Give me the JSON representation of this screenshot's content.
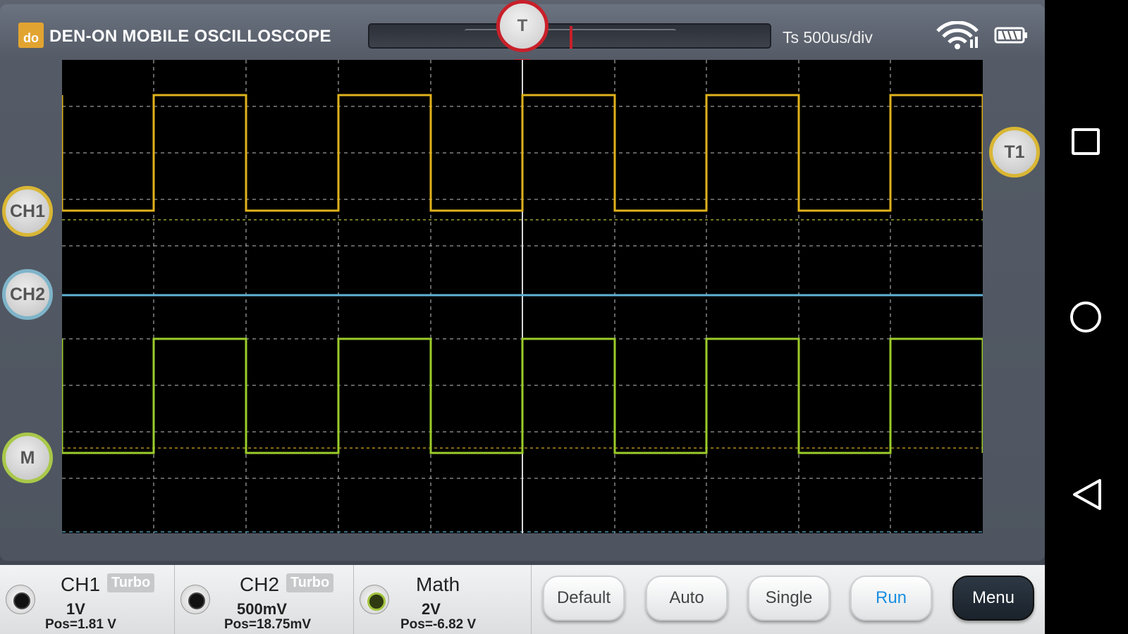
{
  "app": {
    "logo_text": "do",
    "title": "DEN-ON MOBILE OSCILLOSCOPE",
    "timebase": "Ts 500us/div",
    "trigger_label": "T"
  },
  "knobs": {
    "ch1": "CH1",
    "ch2": "CH2",
    "math": "M",
    "t1": "T1"
  },
  "channels": [
    {
      "name": "CH1",
      "badge": "Turbo",
      "scale": "1V",
      "pos": "Pos=1.81 V"
    },
    {
      "name": "CH2",
      "badge": "Turbo",
      "scale": "500mV",
      "pos": "Pos=18.75mV"
    },
    {
      "name": "Math",
      "scale": "2V",
      "pos": "Pos=-6.82 V"
    }
  ],
  "buttons": {
    "default": "Default",
    "auto": "Auto",
    "single": "Single",
    "run": "Run",
    "menu": "Menu"
  },
  "colors": {
    "ch1": "#e0b21c",
    "ch2": "#5fb3d6",
    "math": "#9ccc2a",
    "trigger": "#c8202a"
  },
  "icons": [
    "wifi-icon",
    "battery-icon",
    "overview-icon",
    "home-icon",
    "back-icon"
  ]
}
